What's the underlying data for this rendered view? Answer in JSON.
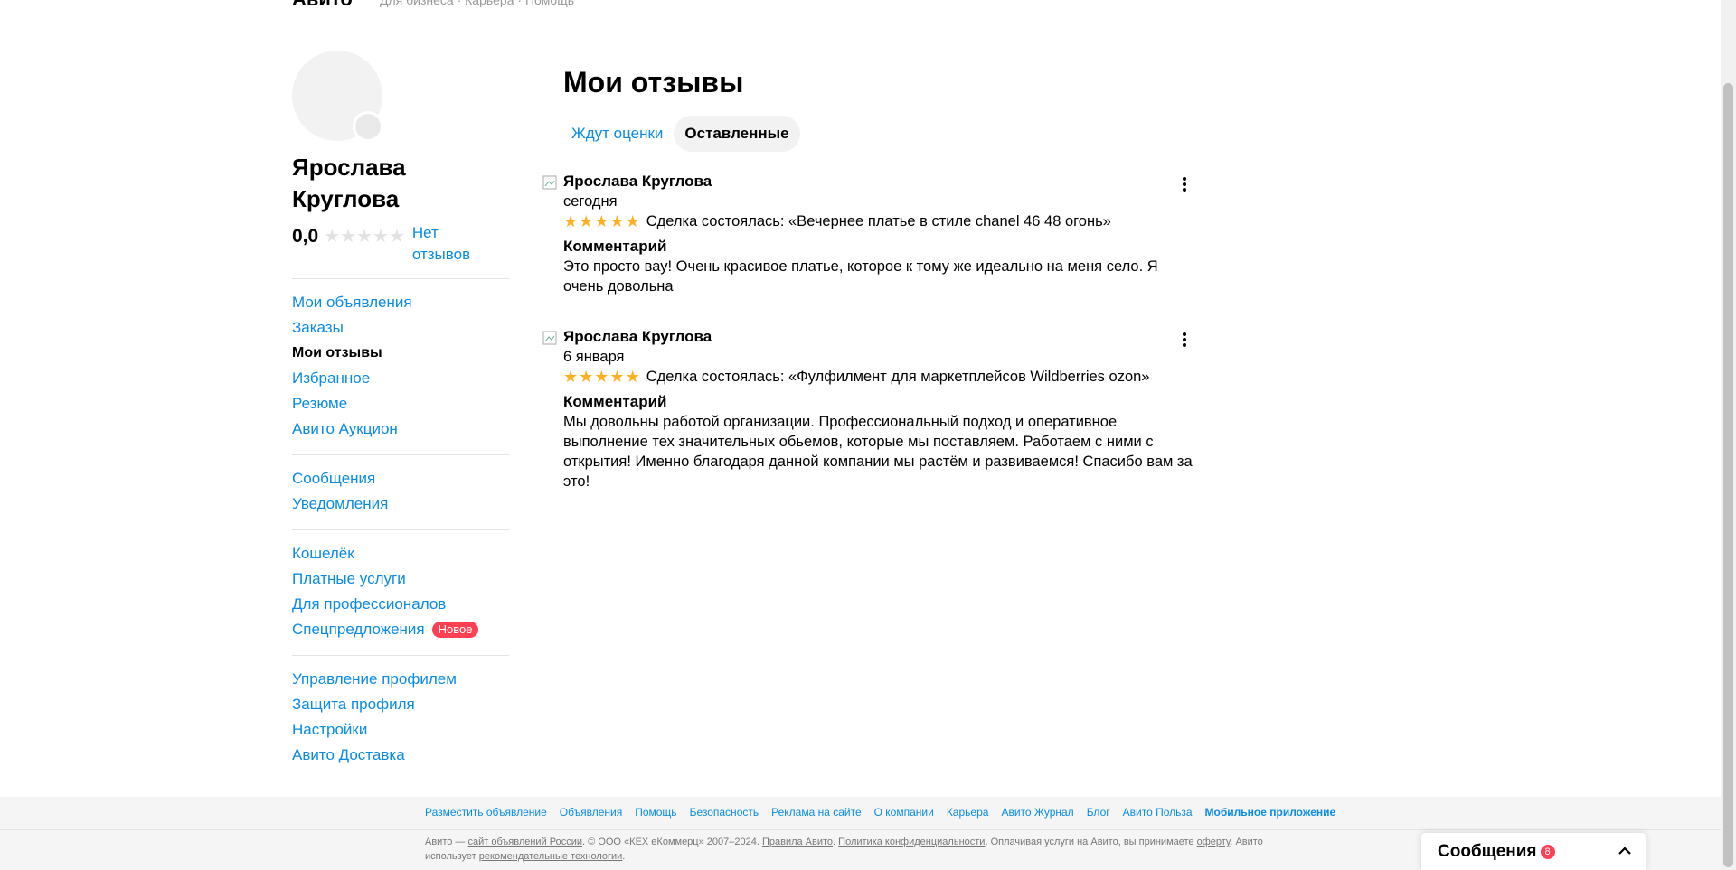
{
  "header": {
    "logo": "Авито",
    "breadcrumb": "Для бизнеса · Карьера · Помощь"
  },
  "sidebar": {
    "name": "Ярослава Круглова",
    "rating": "0,0",
    "no_reviews": "Нет отзывов",
    "groups": [
      [
        {
          "label": "Мои объявления",
          "active": false
        },
        {
          "label": "Заказы",
          "active": false
        },
        {
          "label": "Мои отзывы",
          "active": true
        },
        {
          "label": "Избранное",
          "active": false
        },
        {
          "label": "Резюме",
          "active": false
        },
        {
          "label": "Авито Аукцион",
          "active": false
        }
      ],
      [
        {
          "label": "Сообщения"
        },
        {
          "label": "Уведомления"
        }
      ],
      [
        {
          "label": "Кошелёк"
        },
        {
          "label": "Платные услуги"
        },
        {
          "label": "Для профессионалов"
        },
        {
          "label": "Спецпредложения",
          "badge": "Новое"
        }
      ],
      [
        {
          "label": "Управление профилем"
        },
        {
          "label": "Защита профиля"
        },
        {
          "label": "Настройки"
        },
        {
          "label": "Авито Доставка"
        }
      ]
    ]
  },
  "main": {
    "title": "Мои отзывы",
    "tabs": [
      {
        "label": "Ждут оценки",
        "active": false
      },
      {
        "label": "Оставленные",
        "active": true
      }
    ],
    "reviews": [
      {
        "author": "Ярослава Круглова",
        "date": "сегодня",
        "stars": 5,
        "deal": "Сделка состоялась: «Вечернее платье в стиле chanel 46 48 огонь»",
        "comment_label": "Комментарий",
        "comment": "Это просто вау! Очень красивое платье, которое к тому же идеально на меня село. Я очень довольна"
      },
      {
        "author": "Ярослава Круглова",
        "date": "6 января",
        "stars": 5,
        "deal": "Сделка состоялась: «Фулфилмент для маркетплейсов Wildberries ozon»",
        "comment_label": "Комментарий",
        "comment": "Мы довольны работой организации. Профессиональный подход и оперативное выполнение тех значительных обьемов, которые мы поставляем. Работаем с ними с открытия! Именно благодаря данной компании мы растём и развиваемся! Спасибо вам за это!"
      }
    ]
  },
  "footer": {
    "links": [
      "Разместить объявление",
      "Объявления",
      "Помощь",
      "Безопасность",
      "Реклама на сайте",
      "О компании",
      "Карьера",
      "Авито Журнал",
      "Блог",
      "Авито Польза"
    ],
    "mobile_link": "Мобильное приложение",
    "legal": {
      "p1": "Авито — ",
      "l1": "сайт объявлений России",
      "p2": ". © ООО «КЕХ еКоммерц» 2007–2024. ",
      "l2": "Правила Авито",
      "p3": ". ",
      "l3": "Политика конфиденциальности",
      "p4": ". Оплачивая услуги на Авито, вы принимаете ",
      "l4": "оферту",
      "p5": ". Авито использует ",
      "l5": "рекомендательные технологии",
      "p6": "."
    }
  },
  "messenger": {
    "title": "Сообщения",
    "count": "8"
  },
  "colors": {
    "link": "#0a8be6",
    "star_gold": "#ffb021",
    "star_grey": "#e2e2e2",
    "badge": "#ff4053"
  },
  "icons": [
    "more-vertical-icon",
    "chevron-up-icon",
    "broken-image-icon",
    "star-icon"
  ]
}
